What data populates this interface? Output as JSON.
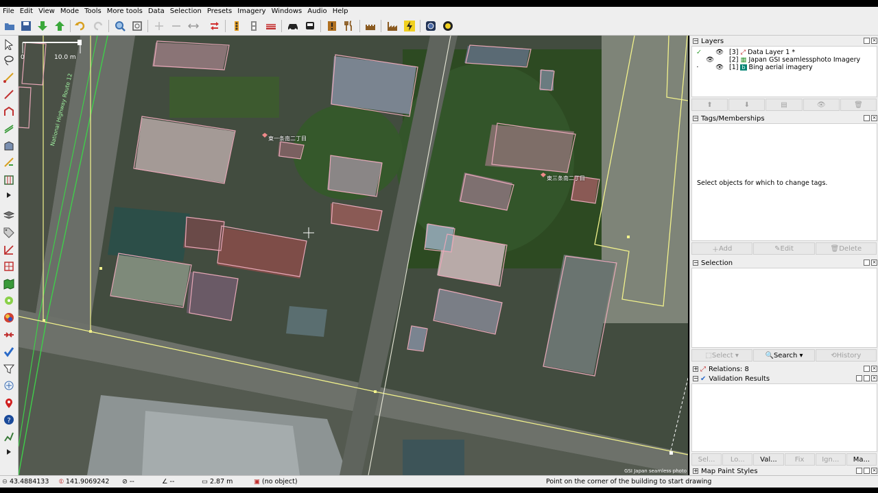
{
  "menu": [
    "File",
    "Edit",
    "View",
    "Mode",
    "Tools",
    "More tools",
    "Data",
    "Selection",
    "Presets",
    "Imagery",
    "Windows",
    "Audio",
    "Help"
  ],
  "toolbar_icons": [
    "open-file-icon",
    "save-icon",
    "download-icon",
    "upload-icon",
    "undo-icon",
    "redo-icon",
    "zoom-icon",
    "zoom-fit-icon",
    "align-circle-icon",
    "align-line-icon",
    "orthogonalize-icon",
    "reverse-way-icon",
    "traffic-light-icon",
    "crossing-icon",
    "barrier-icon",
    "car-icon",
    "bus-icon",
    "info-icon",
    "restaurant-icon",
    "castle-icon",
    "industrial-icon",
    "power-icon",
    "camera-icon",
    "sun-icon"
  ],
  "map": {
    "scale_left": "0",
    "scale_right": "10.0 m",
    "label_highway": "National Highway Route 12",
    "label_addr1": "東一条南二丁目",
    "label_addr2": "東三条南二丁目",
    "attribution": "GSI Japan seamless photo"
  },
  "layers": {
    "title": "Layers",
    "items": [
      {
        "index": "[3]",
        "name": "Data Layer 1 *"
      },
      {
        "index": "[2]",
        "name": "Japan GSI seamlessphoto Imagery"
      },
      {
        "index": "[1]",
        "name": "Bing aerial imagery"
      }
    ]
  },
  "tags": {
    "title": "Tags/Memberships",
    "empty_text": "Select objects for which to change tags.",
    "add": "Add",
    "edit": "Edit",
    "delete": "Delete"
  },
  "selection": {
    "title": "Selection",
    "select": "Select",
    "search": "Search",
    "history": "History"
  },
  "relations": {
    "title": "Relations: 8"
  },
  "validation": {
    "title": "Validation Results",
    "tabs": [
      "Sel...",
      "Lo...",
      "Val...",
      "Fix",
      "Ign...",
      "Ma..."
    ]
  },
  "mappaint": {
    "title": "Map Paint Styles"
  },
  "status": {
    "lat": "43.4884133",
    "lon": "141.9069242",
    "heading": "--",
    "angle": "--",
    "distance": "2.87 m",
    "object": "(no object)",
    "help": "Point on the corner of the building to start drawing"
  },
  "colors": {
    "way_yellow": "#f2f28c",
    "building": "#e8a8b8",
    "highway_green": "#3fcf4a",
    "panel_bg": "#eeeeee"
  }
}
